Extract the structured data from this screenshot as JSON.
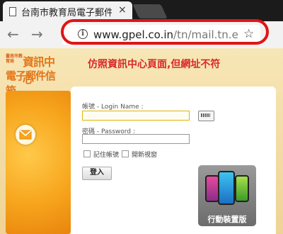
{
  "browser": {
    "tab_title": "台南市教育局電子郵件",
    "tab_close": "×",
    "nav": {
      "back": "←",
      "forward": "→"
    },
    "url_host": "www.gpel.co.in",
    "url_path": "/tn/mail.tn.edu.",
    "info_glyph": "i",
    "star_glyph": "☆"
  },
  "annotation": "仿照資訊中心頁面,但網址不符",
  "logo": {
    "small_text": "臺南市教育局",
    "line1": "資訊中心",
    "line2": "電子郵件信箱"
  },
  "login": {
    "username_label": "帳號 - Login Name :",
    "password_label": "密碼 - Password :",
    "remember_label": "記住帳號",
    "newwindow_label": "開新視窗",
    "submit_label": "登入",
    "mobile_label": "行動裝置版"
  },
  "colors": {
    "annotation_red": "#d8282a",
    "highlight_ring": "#e01515",
    "logo_orange": "#e27619",
    "panel_orange": "#f7a51c"
  },
  "icons": [
    "document-icon",
    "close-icon",
    "back-arrow-icon",
    "forward-arrow-icon",
    "info-icon",
    "star-icon",
    "mail-icon",
    "keyboard-icon",
    "phones-icon"
  ]
}
